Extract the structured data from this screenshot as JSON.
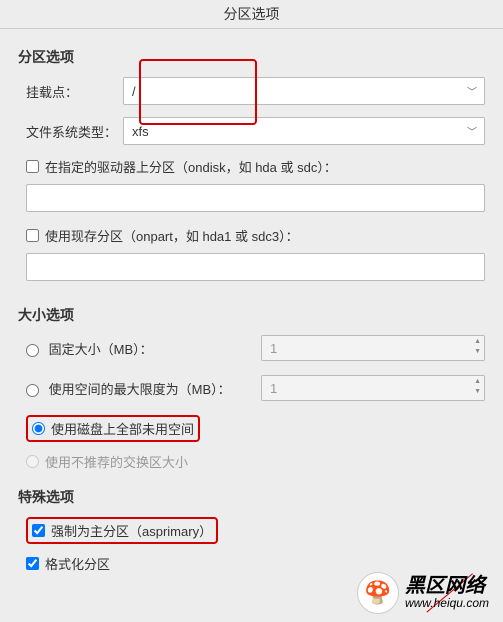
{
  "window_title": "分区选项",
  "sections": {
    "partition": {
      "title": "分区选项",
      "mount_point_label": "挂载点：",
      "mount_point_value": "/",
      "fs_type_label": "文件系统类型：",
      "fs_type_value": "xfs",
      "ondisk_label": "在指定的驱动器上分区（ondisk，如 hda 或 sdc）：",
      "ondisk_value": "",
      "onpart_label": "使用现存分区（onpart，如 hda1 或 sdc3）：",
      "onpart_value": ""
    },
    "size": {
      "title": "大小选项",
      "fixed_label": "固定大小（MB）：",
      "fixed_value": "1",
      "max_label": "使用空间的最大限度为（MB）：",
      "max_value": "1",
      "all_free_label": "使用磁盘上全部未用空间",
      "recommended_swap_label": "使用不推荐的交换区大小"
    },
    "special": {
      "title": "特殊选项",
      "asprimary_label": "强制为主分区（asprimary）",
      "format_label": "格式化分区"
    }
  },
  "watermark": {
    "mushroom": "🍄",
    "cn": "黑区网络",
    "url": "www.heiqu.com"
  }
}
